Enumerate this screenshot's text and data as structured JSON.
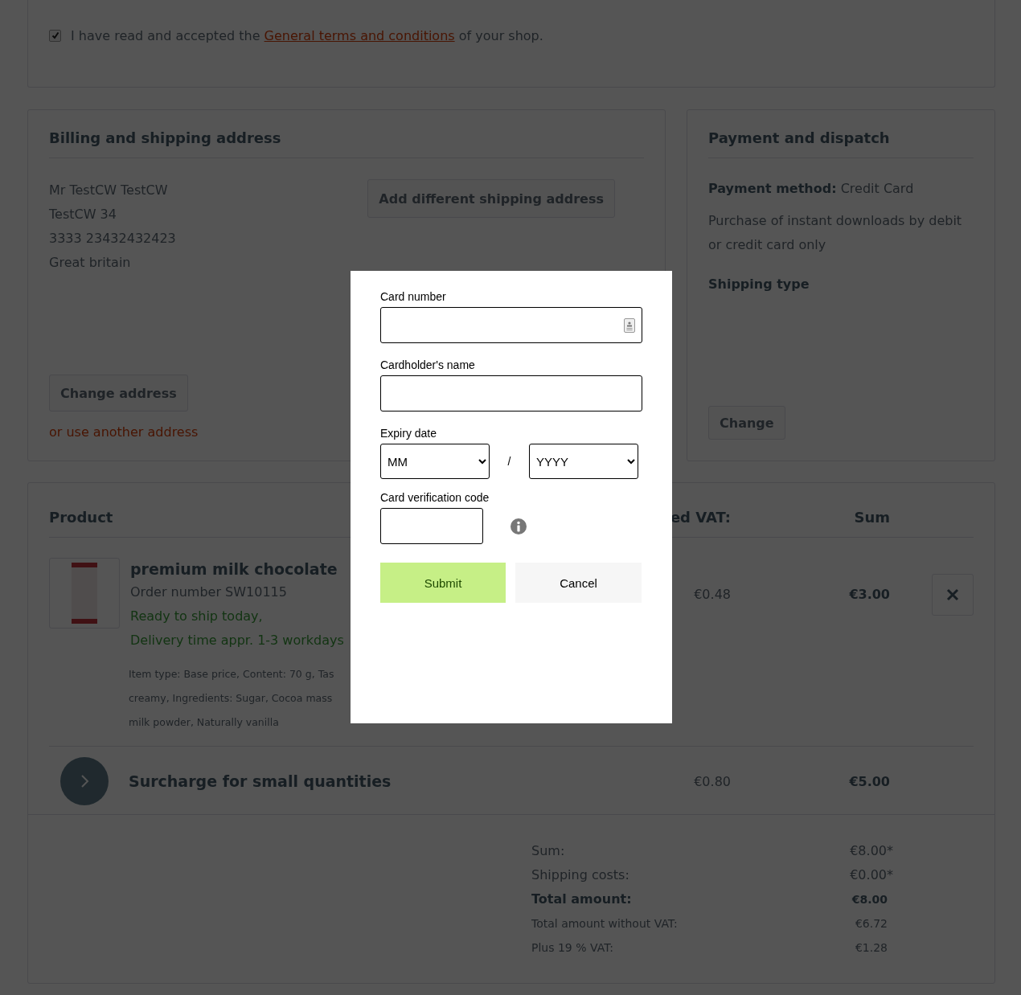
{
  "terms": {
    "checked": true,
    "text_before": "I have read and accepted the",
    "link": "General terms and conditions",
    "text_after": "of your shop."
  },
  "billing": {
    "title": "Billing and shipping address",
    "address_lines": [
      "Mr TestCW TestCW",
      "TestCW 34",
      "3333 23432432423",
      "Great britain"
    ],
    "add_shipping_button": "Add different shipping address",
    "change_button": "Change address",
    "other_address_link": "or use another address"
  },
  "payment": {
    "title": "Payment and dispatch",
    "method_label": "Payment method:",
    "method_value": "Credit Card",
    "note": "Purchase of instant downloads by debit or credit card only",
    "shipping_type_label": "Shipping type",
    "change_button": "Change"
  },
  "cart": {
    "columns": [
      {
        "label": "Product"
      },
      {
        "label": "ed VAT:"
      },
      {
        "label": "Sum"
      }
    ],
    "items": [
      {
        "kind": "product",
        "name": "premium milk chocolate",
        "order_number": "Order number SW10115",
        "availability": [
          "Ready to ship today,",
          "Delivery time appr. 1-3 workdays"
        ],
        "details": [
          "Item type: Base price, Content: 70 g, Tas",
          "creamy, Ingredients: Sugar, Cocoa mass",
          "milk powder, Naturally vanilla"
        ],
        "vat": "€0.48",
        "sum": "€3.00"
      },
      {
        "kind": "surcharge",
        "name": "Surcharge for small quantities",
        "vat": "€0.80",
        "sum": "€5.00"
      }
    ],
    "summary": [
      {
        "kind": "regular",
        "label": "Sum:",
        "value": "€8.00*"
      },
      {
        "kind": "regular",
        "label": "Shipping costs:",
        "value": "€0.00*"
      },
      {
        "kind": "total",
        "label": "Total amount:",
        "value": "€8.00"
      },
      {
        "kind": "small",
        "label": "Total amount without VAT:",
        "value": "€6.72"
      },
      {
        "kind": "small",
        "label": "Plus 19 % VAT:",
        "value": "€1.28"
      }
    ]
  },
  "modal": {
    "card_number_label": "Card number",
    "cardholder_label": "Cardholder's name",
    "expiry_label": "Expiry date",
    "month": {
      "value": "MM"
    },
    "separator": "/",
    "year": {
      "value": "YYYY"
    },
    "cvc_label": "Card verification code",
    "submit_button": "Submit",
    "cancel_button": "Cancel"
  }
}
